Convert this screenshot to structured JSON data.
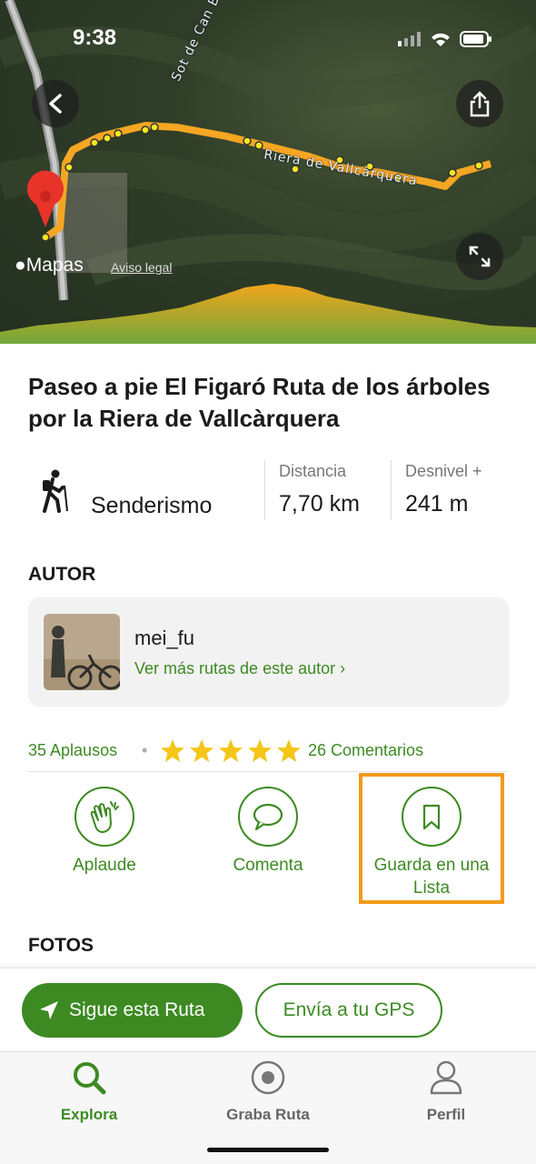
{
  "status_bar": {
    "time": "9:38"
  },
  "map": {
    "brand": "Mapas",
    "legal": "Aviso legal",
    "labels": [
      "Sot de Can Baci",
      "Riera de Vallcàrquera"
    ]
  },
  "route": {
    "title": "Paseo a pie El Figaró Ruta de los árboles por la Riera de Vallcàrquera",
    "activity": "Senderismo",
    "distance_label": "Distancia",
    "distance_value": "7,70 km",
    "elevation_label": "Desnivel +",
    "elevation_value": "241 m"
  },
  "author": {
    "section_title": "AUTOR",
    "name": "mei_fu",
    "more_routes": "Ver más rutas de este autor ›"
  },
  "social": {
    "applause": "35 Aplausos",
    "separator": "•",
    "rating": 5,
    "comments": "26 Comentarios"
  },
  "actions": [
    {
      "label": "Aplaude",
      "icon": "clap-icon"
    },
    {
      "label": "Comenta",
      "icon": "comment-icon"
    },
    {
      "label": "Guarda en una Lista",
      "icon": "bookmark-icon"
    }
  ],
  "photos": {
    "section_title": "FOTOS"
  },
  "bottom_actions": {
    "follow": "Sigue esta Ruta",
    "send_gps": "Envía a tu GPS"
  },
  "tabs": [
    {
      "label": "Explora",
      "icon": "search-icon",
      "active": true
    },
    {
      "label": "Graba Ruta",
      "icon": "record-icon",
      "active": false
    },
    {
      "label": "Perfil",
      "icon": "user-icon",
      "active": false
    }
  ],
  "colors": {
    "accent": "#3d8a23",
    "route": "#f5a623",
    "highlight": "#f29a1a",
    "star": "#f5c518"
  }
}
